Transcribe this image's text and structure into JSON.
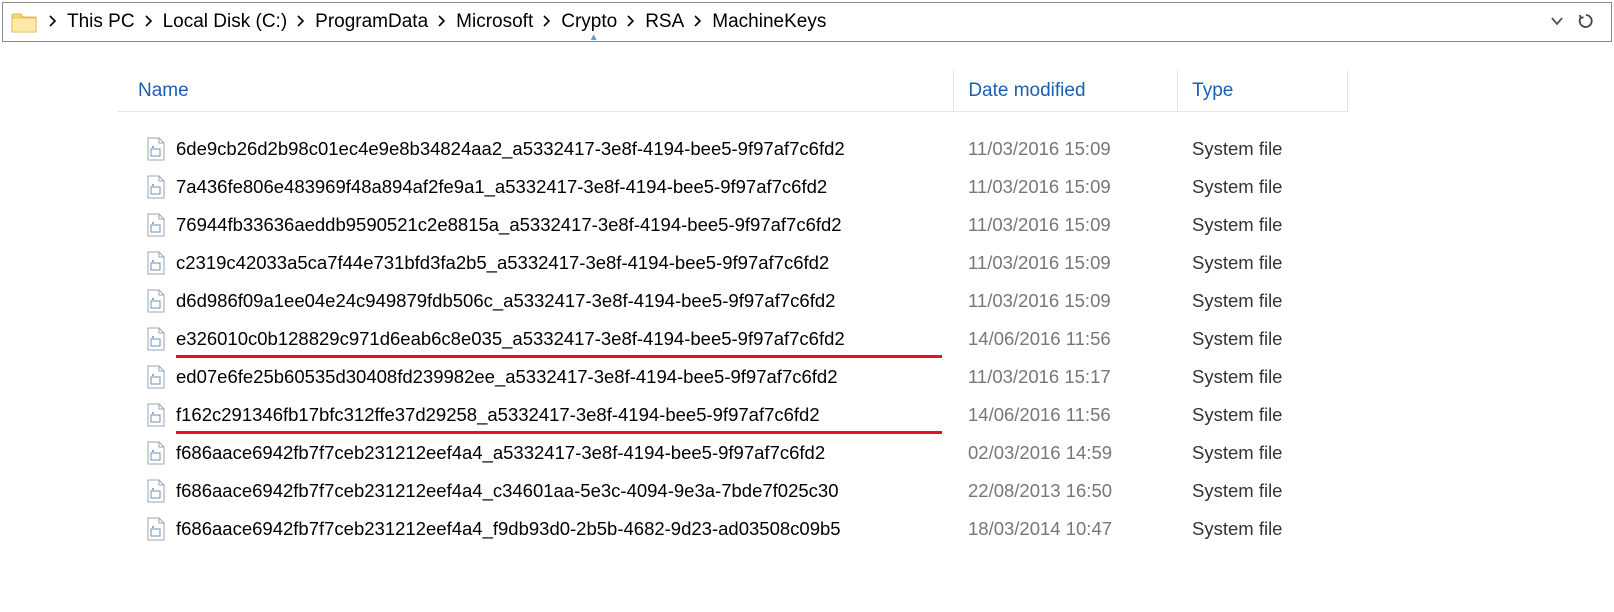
{
  "breadcrumb": {
    "items": [
      "This PC",
      "Local Disk (C:)",
      "ProgramData",
      "Microsoft",
      "Crypto",
      "RSA",
      "MachineKeys"
    ]
  },
  "columns": {
    "name": "Name",
    "date": "Date modified",
    "type": "Type",
    "sorted_by": "Name",
    "sort_direction": "ascending"
  },
  "files": [
    {
      "name": "6de9cb26d2b98c01ec4e9e8b34824aa2_a5332417-3e8f-4194-bee5-9f97af7c6fd2",
      "date": "11/03/2016 15:09",
      "type": "System file",
      "highlight": false
    },
    {
      "name": "7a436fe806e483969f48a894af2fe9a1_a5332417-3e8f-4194-bee5-9f97af7c6fd2",
      "date": "11/03/2016 15:09",
      "type": "System file",
      "highlight": false
    },
    {
      "name": "76944fb33636aeddb9590521c2e8815a_a5332417-3e8f-4194-bee5-9f97af7c6fd2",
      "date": "11/03/2016 15:09",
      "type": "System file",
      "highlight": false
    },
    {
      "name": "c2319c42033a5ca7f44e731bfd3fa2b5_a5332417-3e8f-4194-bee5-9f97af7c6fd2",
      "date": "11/03/2016 15:09",
      "type": "System file",
      "highlight": false
    },
    {
      "name": "d6d986f09a1ee04e24c949879fdb506c_a5332417-3e8f-4194-bee5-9f97af7c6fd2",
      "date": "11/03/2016 15:09",
      "type": "System file",
      "highlight": false
    },
    {
      "name": "e326010c0b128829c971d6eab6c8e035_a5332417-3e8f-4194-bee5-9f97af7c6fd2",
      "date": "14/06/2016 11:56",
      "type": "System file",
      "highlight": true
    },
    {
      "name": "ed07e6fe25b60535d30408fd239982ee_a5332417-3e8f-4194-bee5-9f97af7c6fd2",
      "date": "11/03/2016 15:17",
      "type": "System file",
      "highlight": false
    },
    {
      "name": "f162c291346fb17bfc312ffe37d29258_a5332417-3e8f-4194-bee5-9f97af7c6fd2",
      "date": "14/06/2016 11:56",
      "type": "System file",
      "highlight": true
    },
    {
      "name": "f686aace6942fb7f7ceb231212eef4a4_a5332417-3e8f-4194-bee5-9f97af7c6fd2",
      "date": "02/03/2016 14:59",
      "type": "System file",
      "highlight": false
    },
    {
      "name": "f686aace6942fb7f7ceb231212eef4a4_c34601aa-5e3c-4094-9e3a-7bde7f025c30",
      "date": "22/08/2013 16:50",
      "type": "System file",
      "highlight": false
    },
    {
      "name": "f686aace6942fb7f7ceb231212eef4a4_f9db93d0-2b5b-4682-9d23-ad03508c09b5",
      "date": "18/03/2014 10:47",
      "type": "System file",
      "highlight": false
    }
  ]
}
